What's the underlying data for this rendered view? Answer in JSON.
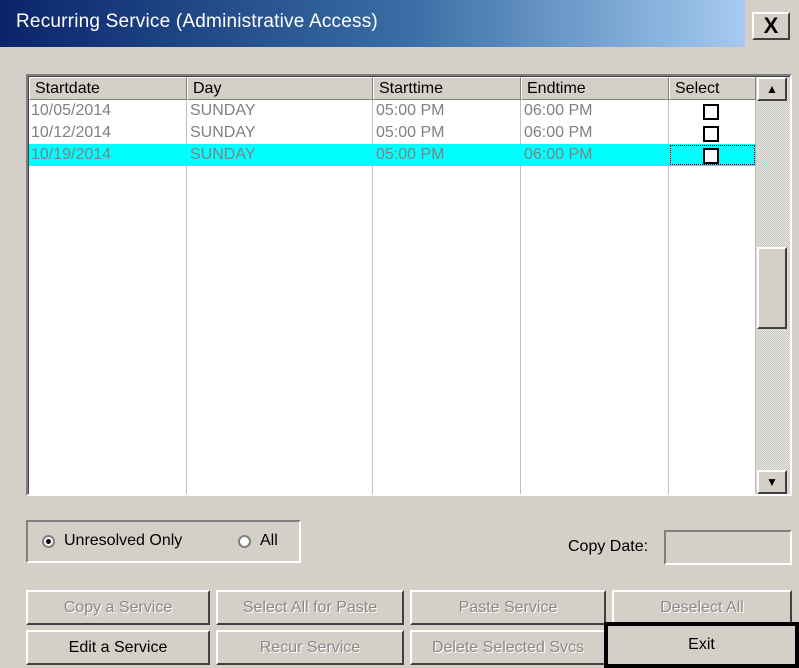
{
  "window": {
    "title": "Recurring Service (Administrative Access)",
    "close_label": "X"
  },
  "grid": {
    "columns": [
      "Startdate",
      "Day",
      "Starttime",
      "Endtime",
      "Select"
    ],
    "rows": [
      {
        "startdate": "10/05/2014",
        "day": "SUNDAY",
        "starttime": "05:00 PM",
        "endtime": "06:00 PM",
        "selected": false
      },
      {
        "startdate": "10/12/2014",
        "day": "SUNDAY",
        "starttime": "05:00 PM",
        "endtime": "06:00 PM",
        "selected": false
      },
      {
        "startdate": "10/19/2014",
        "day": "SUNDAY",
        "starttime": "05:00 PM",
        "endtime": "06:00 PM",
        "selected": true
      }
    ],
    "selection_color": "#00ffff",
    "scroll_up_icon": "arrow-up-icon",
    "scroll_down_icon": "arrow-down-icon"
  },
  "filter": {
    "options": [
      {
        "label": "Unresolved Only",
        "checked": true
      },
      {
        "label": "All",
        "checked": false
      }
    ]
  },
  "copy_date": {
    "label": "Copy Date:",
    "value": ""
  },
  "buttons": {
    "copy_service": "Copy a Service",
    "select_all_paste": "Select All  for Paste",
    "paste_service": "Paste Service",
    "deselect_all": "Deselect All",
    "edit_service": "Edit a Service",
    "recur_service": "Recur Service",
    "delete_selected": "Delete Selected Svcs",
    "exit": "Exit"
  }
}
